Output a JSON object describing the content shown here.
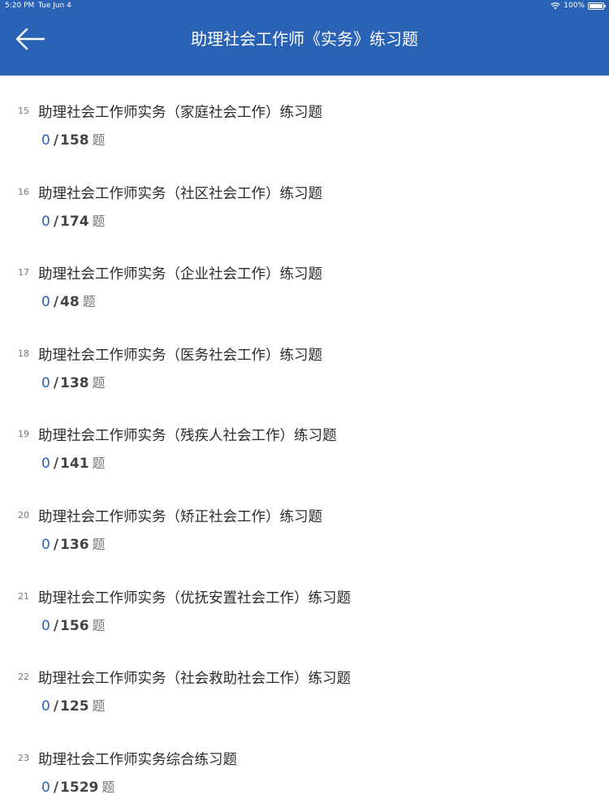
{
  "status": {
    "time": "5:20 PM",
    "date": "Tue Jun 4",
    "battery": "100%"
  },
  "header": {
    "title": "助理社会工作师《实务》练习题",
    "back_icon": "back-arrow-icon",
    "background": "#2a62b6"
  },
  "items": [
    {
      "num": "15",
      "title": "助理社会工作师实务（家庭社会工作）练习题",
      "done": "0",
      "sep": "/",
      "total": "158",
      "unit": "题"
    },
    {
      "num": "16",
      "title": "助理社会工作师实务（社区社会工作）练习题",
      "done": "0",
      "sep": "/",
      "total": "174",
      "unit": "题"
    },
    {
      "num": "17",
      "title": "助理社会工作师实务（企业社会工作）练习题",
      "done": "0",
      "sep": "/",
      "total": "48",
      "unit": "题"
    },
    {
      "num": "18",
      "title": "助理社会工作师实务（医务社会工作）练习题",
      "done": "0",
      "sep": "/",
      "total": "138",
      "unit": "题"
    },
    {
      "num": "19",
      "title": "助理社会工作师实务（残疾人社会工作）练习题",
      "done": "0",
      "sep": "/",
      "total": "141",
      "unit": "题"
    },
    {
      "num": "20",
      "title": "助理社会工作师实务（矫正社会工作）练习题",
      "done": "0",
      "sep": "/",
      "total": "136",
      "unit": "题"
    },
    {
      "num": "21",
      "title": "助理社会工作师实务（优抚安置社会工作）练习题",
      "done": "0",
      "sep": "/",
      "total": "156",
      "unit": "题"
    },
    {
      "num": "22",
      "title": "助理社会工作师实务（社会救助社会工作）练习题",
      "done": "0",
      "sep": "/",
      "total": "125",
      "unit": "题"
    },
    {
      "num": "23",
      "title": "助理社会工作师实务综合练习题",
      "done": "0",
      "sep": "/",
      "total": "1529",
      "unit": "题"
    }
  ]
}
